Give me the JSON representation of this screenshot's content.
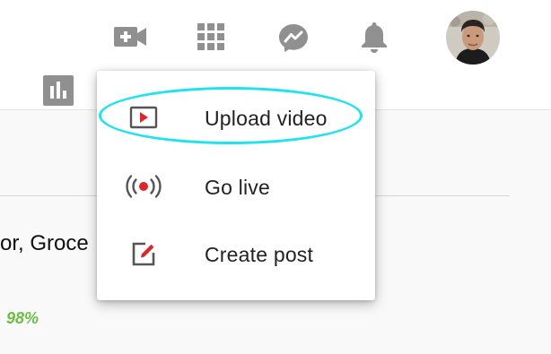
{
  "header": {
    "icons": {
      "create": "video-camera-plus-icon",
      "apps": "apps-grid-icon",
      "messages": "messenger-icon",
      "notifications": "bell-icon",
      "analytics": "analytics-icon"
    },
    "icon_color": "#909090"
  },
  "background": {
    "partial_title": "or, Groce",
    "percent": "98%",
    "percent_color": "#6dbd45"
  },
  "menu": {
    "items": [
      {
        "label": "Upload video",
        "icon": "upload-video-icon"
      },
      {
        "label": "Go live",
        "icon": "go-live-icon"
      },
      {
        "label": "Create post",
        "icon": "create-post-icon"
      }
    ],
    "highlight_color": "#1ee3ee",
    "icon_red": "#e0242c"
  }
}
